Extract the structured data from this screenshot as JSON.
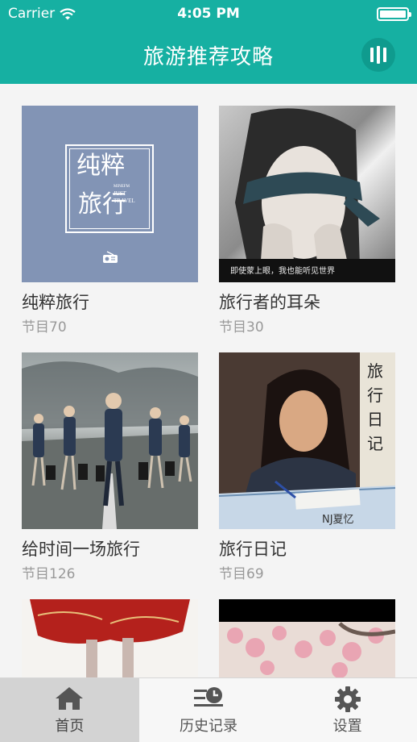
{
  "status_bar": {
    "carrier": "Carrier",
    "time": "4:05 PM"
  },
  "header": {
    "title": "旅游推荐攻略",
    "menu_icon": "bars-icon"
  },
  "cards": [
    {
      "name": "纯粹旅行",
      "count": "节目70",
      "cover_lines": [
        "纯粹",
        "旅行"
      ],
      "cover_sub": [
        "MINEFM",
        "JUST",
        "TRAVEL"
      ]
    },
    {
      "name": "旅行者的耳朵",
      "count": "节目30",
      "cover_caption": "即使蒙上眼，我也能听见世界"
    },
    {
      "name": "给时间一场旅行",
      "count": "节目126"
    },
    {
      "name": "旅行日记",
      "count": "节目69",
      "cover_text": [
        "旅",
        "行",
        "日",
        "记"
      ],
      "cover_signature": "NJ夏忆"
    },
    {
      "name": "",
      "count": ""
    },
    {
      "name": "",
      "count": ""
    }
  ],
  "tabs": [
    {
      "label": "首页",
      "icon": "home-icon",
      "active": true
    },
    {
      "label": "历史记录",
      "icon": "history-icon",
      "active": false
    },
    {
      "label": "设置",
      "icon": "gear-icon",
      "active": false
    }
  ],
  "colors": {
    "header": "#16b0a2",
    "header_button": "#0f9b8e",
    "cover_blue": "#8294b5"
  }
}
